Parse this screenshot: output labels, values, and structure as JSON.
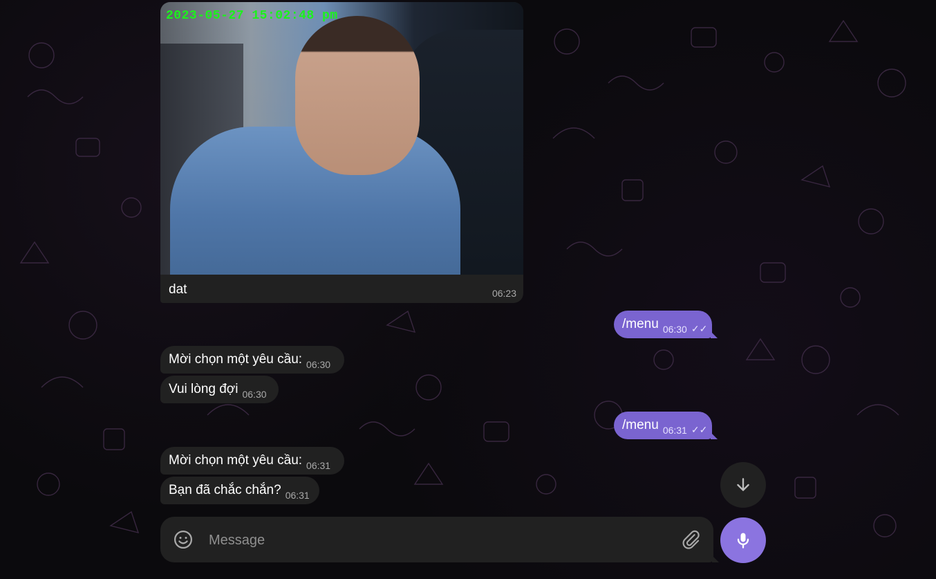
{
  "photo_message": {
    "timestamp_overlay": "2023-05-27 15:02:48 pm",
    "caption": "dat",
    "time": "06:23"
  },
  "messages": [
    {
      "direction": "outgoing",
      "text": "/menu",
      "time": "06:30",
      "status": "read"
    },
    {
      "direction": "incoming",
      "text": "Mời chọn một yêu cầu:",
      "time": "06:30"
    },
    {
      "direction": "incoming",
      "text": "Vui lòng đợi",
      "time": "06:30"
    },
    {
      "direction": "outgoing",
      "text": "/menu",
      "time": "06:31",
      "status": "read"
    },
    {
      "direction": "incoming",
      "text": "Mời chọn một yêu cầu:",
      "time": "06:31"
    },
    {
      "direction": "incoming",
      "text": "Bạn đã chắc chắn?",
      "time": "06:31"
    }
  ],
  "composer": {
    "placeholder": "Message",
    "value": ""
  },
  "icons": {
    "emoji": "emoji-icon",
    "attach": "paperclip-icon",
    "scroll_down": "arrow-down-icon",
    "voice": "microphone-icon",
    "read_status": "double-check-icon"
  },
  "colors": {
    "background": "#0b0a0d",
    "incoming_bubble": "#212121",
    "outgoing_bubble": "#7a64d0",
    "mic_button": "#8b74e0",
    "timestamp_overlay": "#1cf21c"
  }
}
